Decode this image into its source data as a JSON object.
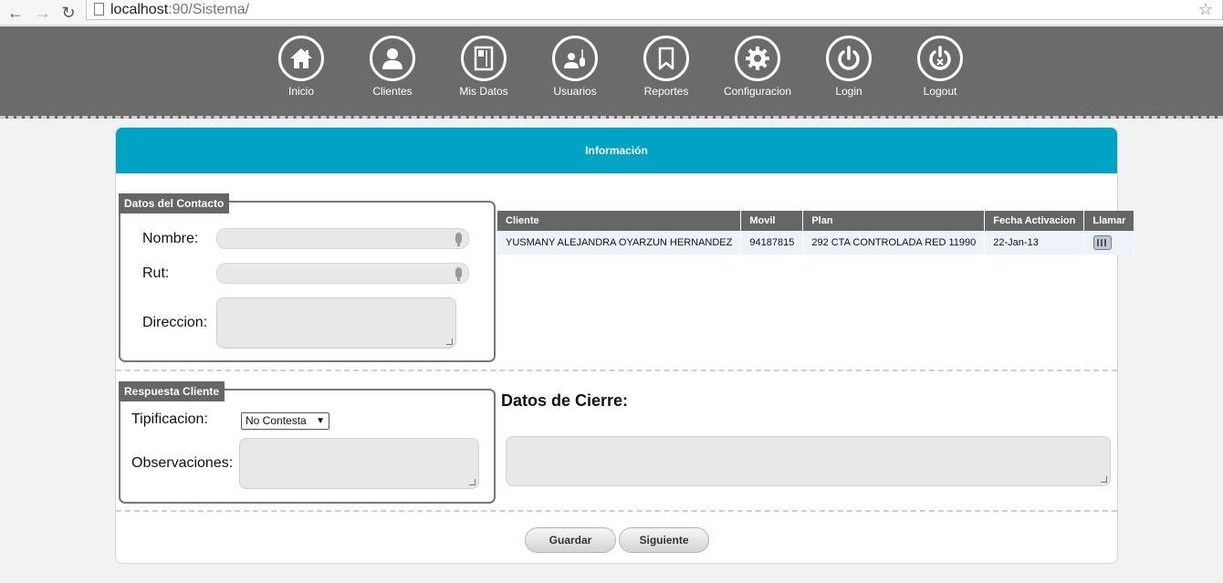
{
  "browser": {
    "url_host": "localhost",
    "url_rest": ":90/Sistema/"
  },
  "nav": {
    "items": [
      {
        "label": "Inicio",
        "icon": "home-icon"
      },
      {
        "label": "Clientes",
        "icon": "user-icon"
      },
      {
        "label": "Mis Datos",
        "icon": "profile-card-icon"
      },
      {
        "label": "Usuarios",
        "icon": "users-icon"
      },
      {
        "label": "Reportes",
        "icon": "bookmark-icon"
      },
      {
        "label": "Configuracion",
        "icon": "gear-icon"
      },
      {
        "label": "Login",
        "icon": "power-icon"
      },
      {
        "label": "Logout",
        "icon": "logout-power-icon"
      }
    ]
  },
  "panel": {
    "title": "Información"
  },
  "contacto": {
    "legend": "Datos del Contacto",
    "nombre_label": "Nombre:",
    "nombre_value": "",
    "rut_label": "Rut:",
    "rut_value": "",
    "direccion_label": "Direccion:",
    "direccion_value": ""
  },
  "table": {
    "headers": [
      "Cliente",
      "Movil",
      "Plan",
      "Fecha Activacion",
      "Llamar"
    ],
    "rows": [
      {
        "cliente": "YUSMANY ALEJANDRA OYARZUN HERNANDEZ",
        "movil": "94187815",
        "plan": "292 CTA CONTROLADA RED 11990",
        "fecha": "22-Jan-13",
        "llamar_icon": "phone-icon"
      }
    ]
  },
  "respuesta": {
    "legend": "Respuesta Cliente",
    "tipificacion_label": "Tipificacion:",
    "tipificacion_value": "No Contesta",
    "observaciones_label": "Observaciones:",
    "observaciones_value": ""
  },
  "cierre": {
    "heading": "Datos de Cierre:",
    "value": ""
  },
  "buttons": {
    "guardar": "Guardar",
    "siguiente": "Siguiente"
  },
  "colors": {
    "header": "#00a3c4",
    "nav_bg": "#6b6b6b",
    "legend_bg": "#666666"
  }
}
